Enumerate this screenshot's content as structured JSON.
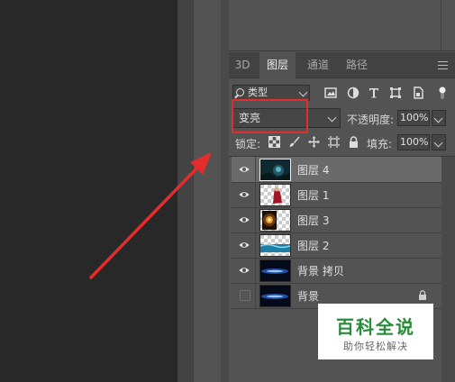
{
  "tabs": [
    {
      "label": "3D"
    },
    {
      "label": "图层",
      "active": true
    },
    {
      "label": "通道"
    },
    {
      "label": "路径"
    }
  ],
  "filter": {
    "label": "类型"
  },
  "blend_mode": {
    "value": "变亮"
  },
  "opacity": {
    "label": "不透明度:",
    "value": "100%"
  },
  "lock": {
    "label": "锁定:"
  },
  "fill": {
    "label": "填充:",
    "value": "100%"
  },
  "layers": [
    {
      "name": "图层 4",
      "visible": true,
      "selected": true,
      "thumb": "dark-teal-image"
    },
    {
      "name": "图层 1",
      "visible": true,
      "thumb": "red-figure-transparent"
    },
    {
      "name": "图层 3",
      "visible": true,
      "thumb": "orange-burst-transparent"
    },
    {
      "name": "图层 2",
      "visible": true,
      "thumb": "blue-water-transparent"
    },
    {
      "name": "背景 拷贝",
      "visible": true,
      "thumb": "blue-streak-image"
    },
    {
      "name": "背景",
      "visible": false,
      "locked": true,
      "thumb": "blue-streak-image"
    }
  ],
  "watermark": {
    "title": "百科全说",
    "subtitle": "助你轻松解决"
  },
  "colors": {
    "highlight": "#e32d2d",
    "panel": "#535353",
    "selected_row": "#6a6a6a",
    "watermark_green": "#2a8c3a"
  }
}
